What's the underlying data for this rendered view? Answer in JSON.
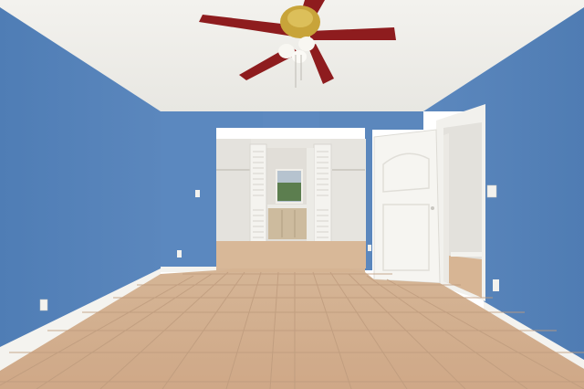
{
  "scene": {
    "description_label": "",
    "colors": {
      "ceiling": "#f1f0ec",
      "wall_blue": "#5a86bd",
      "wall_blue_dark": "#4f79ad",
      "wall_blue_light": "#6a93c6",
      "baseboard": "#f4f3ef",
      "floor_tile": "#d9b798",
      "floor_tile_dark": "#c9a584",
      "grout": "#c4a286",
      "door_white": "#f5f4f0",
      "closet_interior": "#e9e7e2",
      "fan_blade": "#8e1c1e",
      "fan_brass": "#c8a43a",
      "cabinet": "#cdbb9e"
    }
  }
}
